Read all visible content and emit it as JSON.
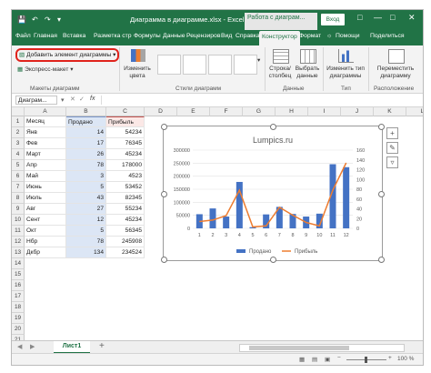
{
  "window": {
    "title": "Диаграмма в диаграмме.xlsx  -  Excel",
    "context_label": "Работа с диаграм...",
    "signin": "Вход"
  },
  "tabs": [
    "Файл",
    "Главная",
    "Вставка",
    "Разметка стр",
    "Формулы",
    "Данные",
    "Рецензиров",
    "Вид",
    "Справка",
    "Конструктор",
    "Формат",
    "Помощи",
    "Поделиться"
  ],
  "ribbon": {
    "add_element": "Добавить элемент диаграммы",
    "express_layout": "Экспресс-макет",
    "change_colors_1": "Изменить",
    "change_colors_2": "цвета",
    "swap_1": "Строка/",
    "swap_2": "столбец",
    "select_1": "Выбрать",
    "select_2": "данные",
    "change_type_1": "Изменить тип",
    "change_type_2": "диаграммы",
    "move_1": "Переместить",
    "move_2": "диаграмму",
    "groups": {
      "layouts": "Макеты диаграмм",
      "styles": "Стили диаграмм",
      "data": "Данные",
      "type": "Тип",
      "location": "Расположение"
    }
  },
  "formula_bar": {
    "name_box": "Диаграм...",
    "fx": "fx"
  },
  "columns": [
    "A",
    "B",
    "C",
    "D",
    "E",
    "F",
    "G",
    "H",
    "I",
    "J",
    "K",
    "L"
  ],
  "table": {
    "headers": [
      "Месяц",
      "Продано",
      "Прибыль"
    ],
    "rows": [
      [
        "Янв",
        "14",
        "54234"
      ],
      [
        "Фев",
        "17",
        "76345"
      ],
      [
        "Март",
        "26",
        "45234"
      ],
      [
        "Апр",
        "78",
        "178000"
      ],
      [
        "Май",
        "3",
        "4523"
      ],
      [
        "Июнь",
        "5",
        "53452"
      ],
      [
        "Июль",
        "43",
        "82345"
      ],
      [
        "Авг",
        "27",
        "55234"
      ],
      [
        "Сент",
        "12",
        "45234"
      ],
      [
        "Окт",
        "5",
        "56345"
      ],
      [
        "Нбр",
        "78",
        "245908"
      ],
      [
        "Дкбр",
        "134",
        "234524"
      ]
    ],
    "row_numbers": [
      "1",
      "2",
      "3",
      "4",
      "5",
      "6",
      "7",
      "8",
      "9",
      "10",
      "11",
      "12",
      "13",
      "14",
      "15",
      "16",
      "17",
      "18",
      "19",
      "20",
      "21"
    ]
  },
  "chart_data": {
    "type": "bar",
    "title": "Lumpics.ru",
    "categories": [
      "1",
      "2",
      "3",
      "4",
      "5",
      "6",
      "7",
      "8",
      "9",
      "10",
      "11",
      "12"
    ],
    "series": [
      {
        "name": "Продано",
        "type": "bar",
        "axis": "left",
        "color": "#4472c4",
        "values": [
          54234,
          76345,
          45234,
          178000,
          4523,
          53452,
          82345,
          55234,
          45234,
          56345,
          245908,
          234524
        ]
      },
      {
        "name": "Прибыль",
        "type": "line",
        "axis": "right",
        "color": "#ed7d31",
        "values": [
          14,
          17,
          26,
          78,
          3,
          5,
          43,
          27,
          12,
          5,
          78,
          134
        ]
      }
    ],
    "ylim_left": [
      0,
      300000
    ],
    "yticks_left": [
      "0",
      "50000",
      "100000",
      "150000",
      "200000",
      "250000",
      "300000"
    ],
    "ylim_right": [
      0,
      160
    ],
    "yticks_right": [
      "0",
      "20",
      "40",
      "60",
      "80",
      "100",
      "120",
      "140",
      "160"
    ],
    "legend_position": "bottom",
    "grid": true
  },
  "sheets": {
    "active": "Лист1",
    "add": "+"
  },
  "status": {
    "zoom": "100 %"
  },
  "colors": {
    "accent": "#217346",
    "bar": "#4472c4",
    "line": "#ed7d31",
    "highlight": "#e0231c"
  }
}
